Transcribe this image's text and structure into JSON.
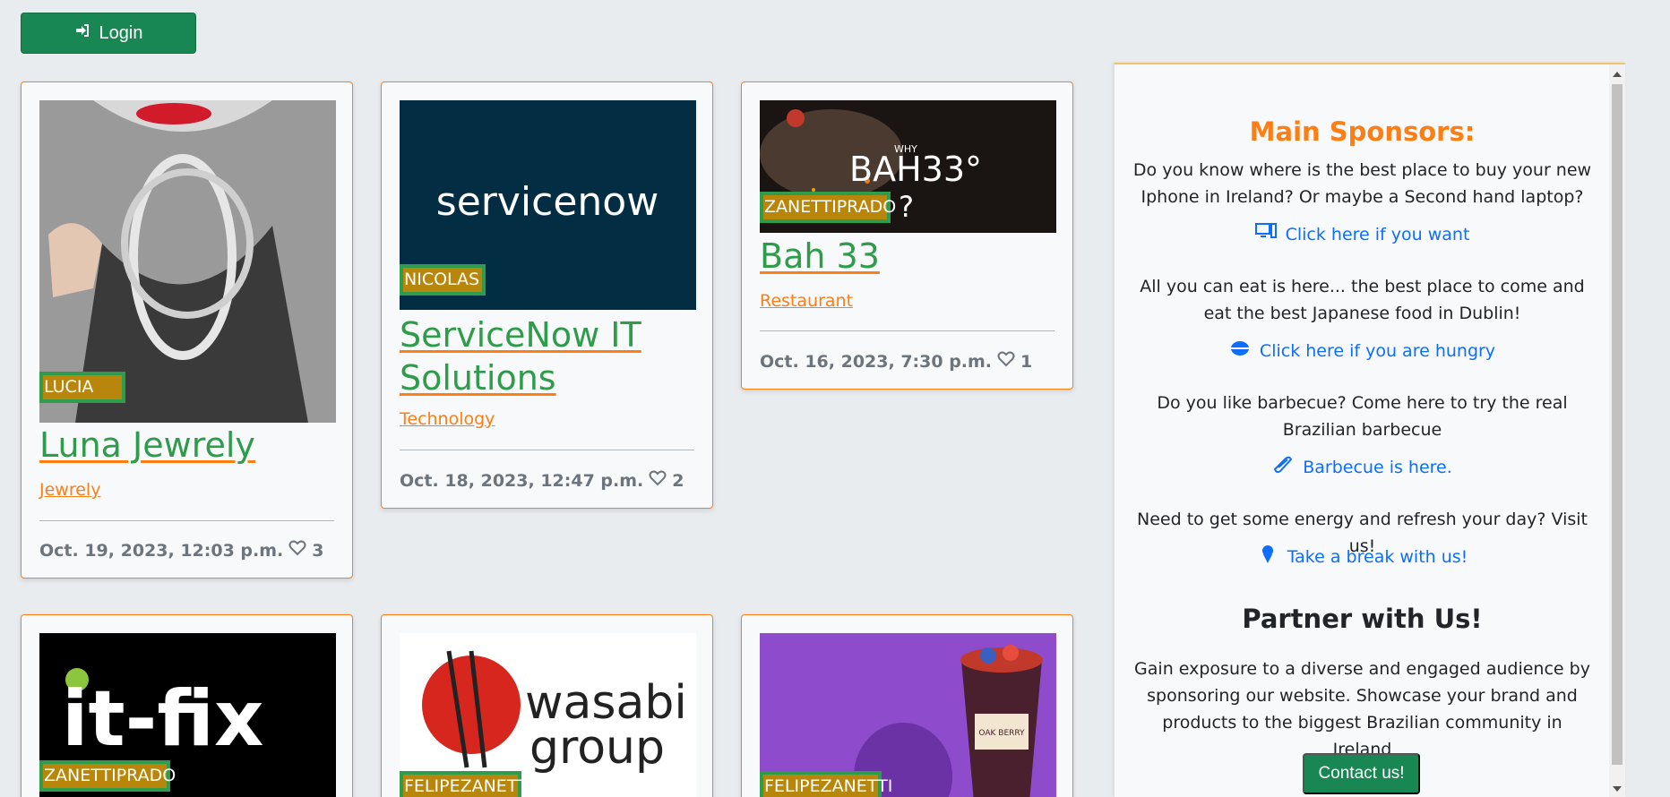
{
  "login": {
    "label": "Login"
  },
  "posts": [
    {
      "author": "LUCIA",
      "title": "Luna Jewrely",
      "category": "Jewrely",
      "date": "Oct. 19, 2023, 12:03 p.m.",
      "likes": "3"
    },
    {
      "author": "NICOLAS",
      "title": "ServiceNow IT Solutions",
      "category": "Technology",
      "date": "Oct. 18, 2023, 12:47 p.m.",
      "likes": "2",
      "image_text": "servicenow"
    },
    {
      "author": "ZANETTIPRADO",
      "title": "Bah 33",
      "category": "Restaurant",
      "date": "Oct. 16, 2023, 7:30 p.m.",
      "likes": "1",
      "image_text": "BAH33°",
      "image_small": "WHY"
    },
    {
      "author": "ZANETTIPRADO",
      "image_text": "it-fix"
    },
    {
      "author": "FELIPEZANETTI",
      "image_text_1": "wasabi",
      "image_text_2": "group"
    },
    {
      "author": "FELIPEZANETTI",
      "image_text": "OAK BERRY"
    }
  ],
  "sidebar": {
    "title": "Main Sponsors:",
    "sponsors": [
      {
        "text": "Do you know where is the best place to buy your new Iphone in Ireland? Or maybe a Second hand laptop?",
        "link": "Click here if you want",
        "icon": "computer-icon"
      },
      {
        "text": "All you can eat is here... the best place to come and eat the best Japanese food in Dublin!",
        "link": "Click here if you are hungry",
        "icon": "bowl-icon"
      },
      {
        "text": "Do you like barbecue? Come here to try the real Brazilian barbecue",
        "link": "Barbecue is here.",
        "icon": "grill-icon"
      },
      {
        "text": "Need to get some energy and refresh your day? Visit us!",
        "link": "Take a break with us!",
        "icon": "ice-cream-icon"
      }
    ],
    "partner_title": "Partner with Us!",
    "partner_text": "Gain exposure to a diverse and engaged audience by sponsoring our website. Showcase your brand and products to the biggest Brazilian community in Ireland",
    "contact_label": "Contact us!"
  },
  "colors": {
    "accent": "#fd7e14",
    "green": "#198754",
    "title_green": "#2e9c4a",
    "link": "#0d6efd"
  }
}
